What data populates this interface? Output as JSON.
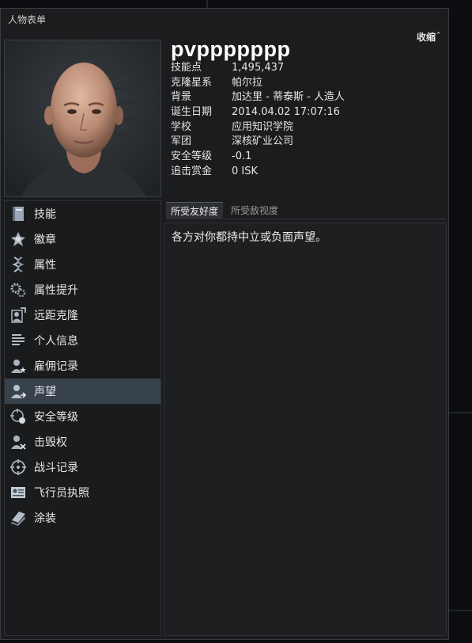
{
  "window": {
    "title": "人物表单",
    "collapse_label": "收缩",
    "collapse_icon": "double-chevron-up-icon"
  },
  "character": {
    "name": "pvppppppp",
    "fields": [
      {
        "label": "技能点",
        "value": "1,495,437"
      },
      {
        "label": "克隆星系",
        "value": "帕尔拉"
      },
      {
        "label": "背景",
        "value": "加达里 - 蒂泰斯 - 人造人"
      },
      {
        "label": "诞生日期",
        "value": "2014.04.02 17:07:16"
      },
      {
        "label": "学校",
        "value": "应用知识学院"
      },
      {
        "label": "军团",
        "value": "深核矿业公司"
      },
      {
        "label": "安全等级",
        "value": "-0.1"
      },
      {
        "label": "追击赏金",
        "value": "0 ISK"
      }
    ]
  },
  "sidebar": {
    "items": [
      {
        "label": "技能",
        "icon": "skillbook-icon"
      },
      {
        "label": "徽章",
        "icon": "medal-icon"
      },
      {
        "label": "属性",
        "icon": "dna-icon"
      },
      {
        "label": "属性提升",
        "icon": "gears-icon"
      },
      {
        "label": "远距克隆",
        "icon": "clone-icon"
      },
      {
        "label": "个人信息",
        "icon": "document-lines-icon"
      },
      {
        "label": "雇佣记录",
        "icon": "person-star-icon"
      },
      {
        "label": "声望",
        "icon": "person-arrow-icon",
        "active": true
      },
      {
        "label": "安全等级",
        "icon": "crosshair-gear-icon"
      },
      {
        "label": "击毁权",
        "icon": "person-x-icon"
      },
      {
        "label": "战斗记录",
        "icon": "target-icon"
      },
      {
        "label": "飞行员执照",
        "icon": "license-icon"
      },
      {
        "label": "涂装",
        "icon": "paint-icon"
      }
    ]
  },
  "tabs": [
    {
      "label": "所受友好度",
      "active": true
    },
    {
      "label": "所受敌视度",
      "active": false
    }
  ],
  "content": {
    "message": "各方对你都持中立或负面声望。"
  },
  "colors": {
    "active_item": "#38424d",
    "window_bg": "#1b1c1e"
  }
}
